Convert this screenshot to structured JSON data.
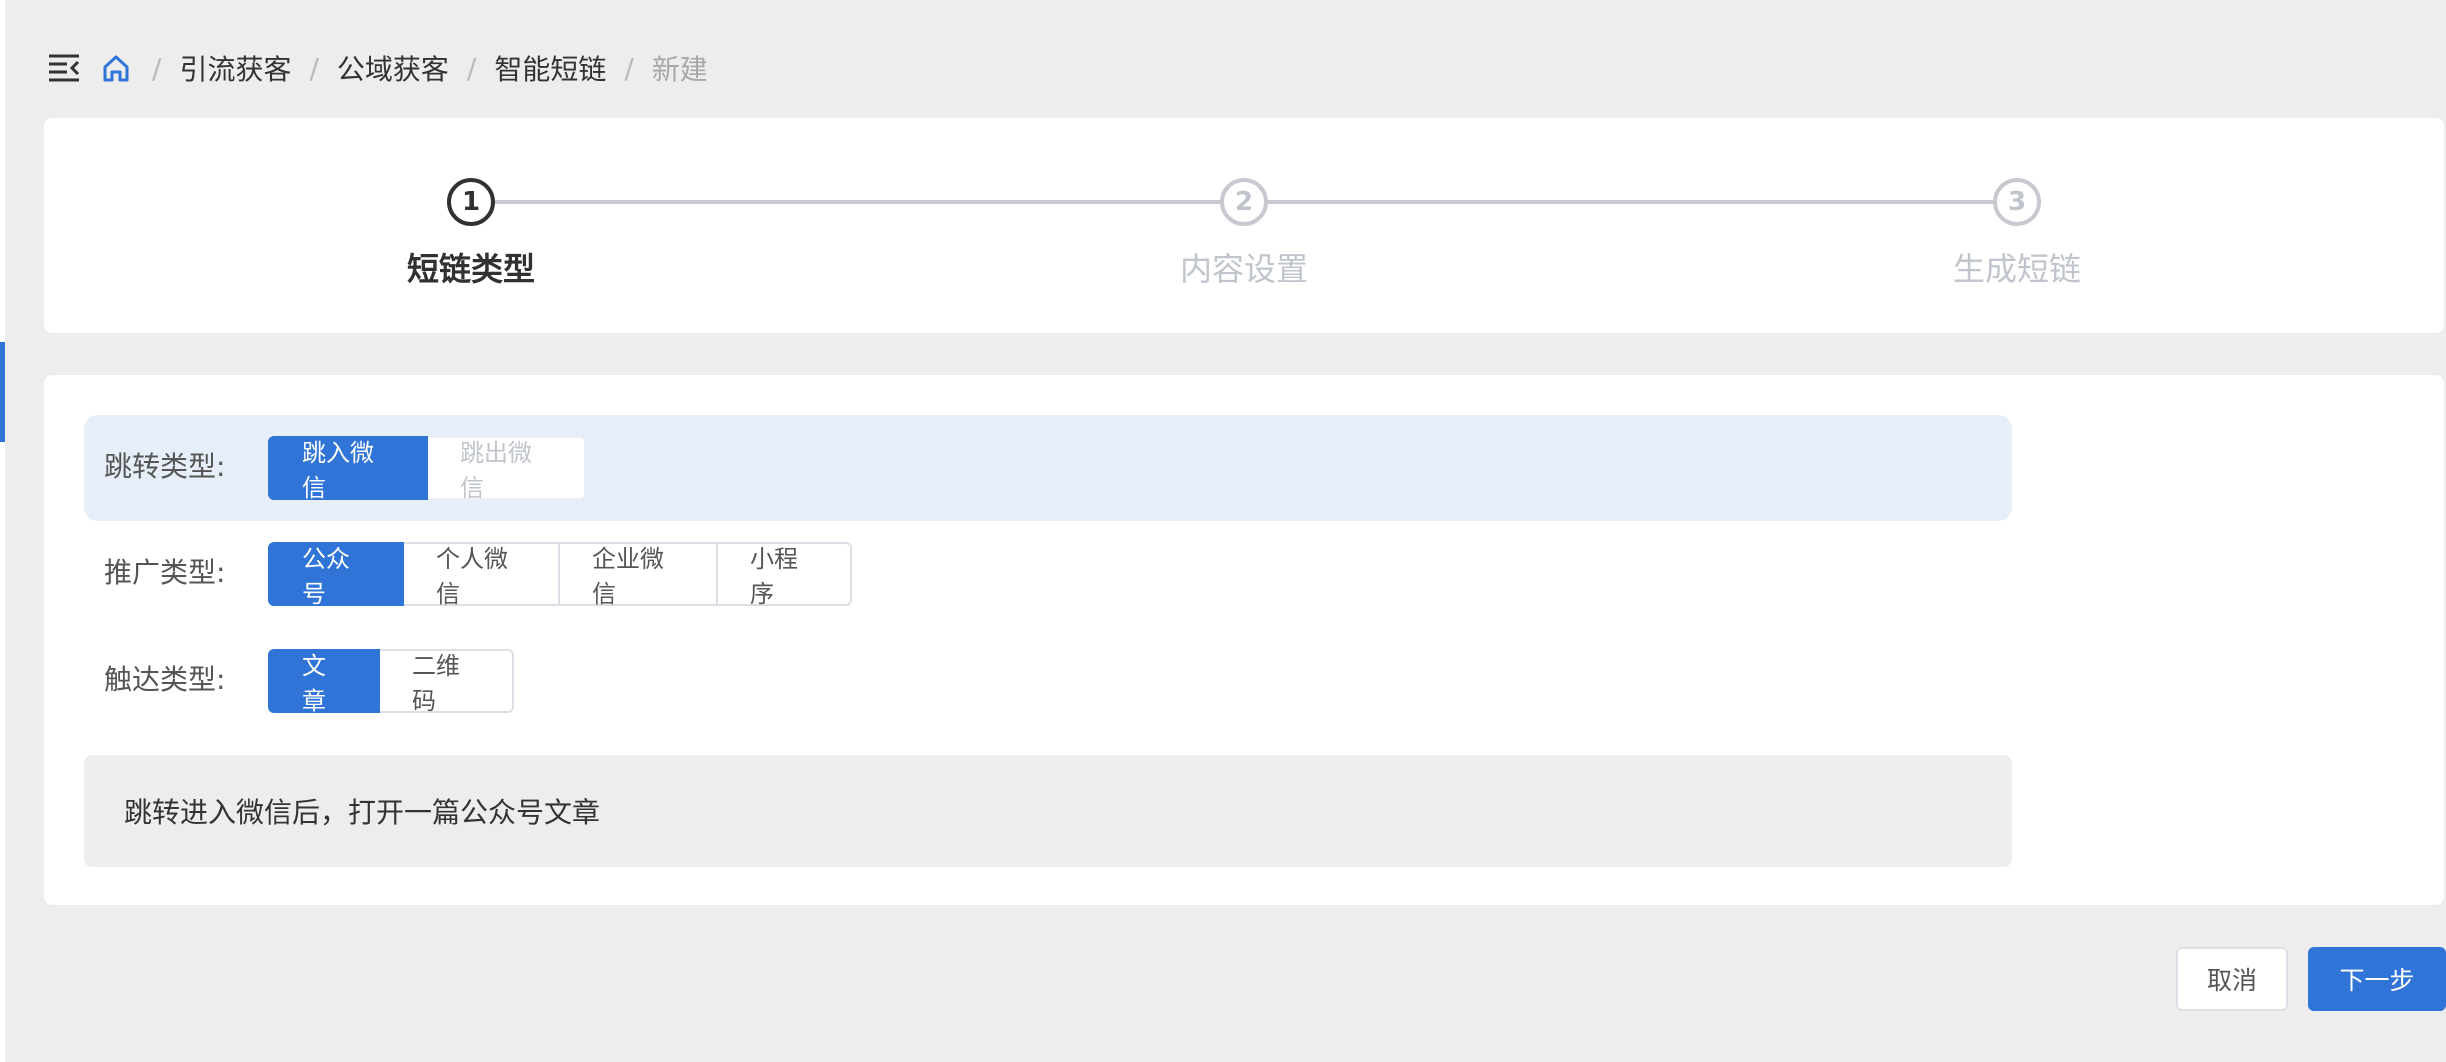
{
  "breadcrumb": {
    "items": [
      "引流获客",
      "公域获客",
      "智能短链"
    ],
    "current": "新建",
    "separator": "/"
  },
  "steps": [
    {
      "number": "1",
      "title": "短链类型",
      "state": "active"
    },
    {
      "number": "2",
      "title": "内容设置",
      "state": "inactive"
    },
    {
      "number": "3",
      "title": "生成短链",
      "state": "inactive"
    }
  ],
  "form": {
    "jump_type": {
      "label": "跳转类型:",
      "options": [
        "跳入微信",
        "跳出微信"
      ],
      "selected": "跳入微信"
    },
    "promo_type": {
      "label": "推广类型:",
      "options": [
        "公众号",
        "个人微信",
        "企业微信",
        "小程序"
      ],
      "selected": "公众号"
    },
    "reach_type": {
      "label": "触达类型:",
      "options": [
        "文章",
        "二维码"
      ],
      "selected": "文章"
    },
    "description": "跳转进入微信后，打开一篇公众号文章"
  },
  "footer": {
    "cancel_label": "取消",
    "next_label": "下一步"
  },
  "colors": {
    "primary": "#2f74d6",
    "highlight_row": "#e6eff9",
    "page_bg": "#ededed"
  },
  "icons": {
    "fold": "menu-fold-icon",
    "home": "home-icon"
  }
}
